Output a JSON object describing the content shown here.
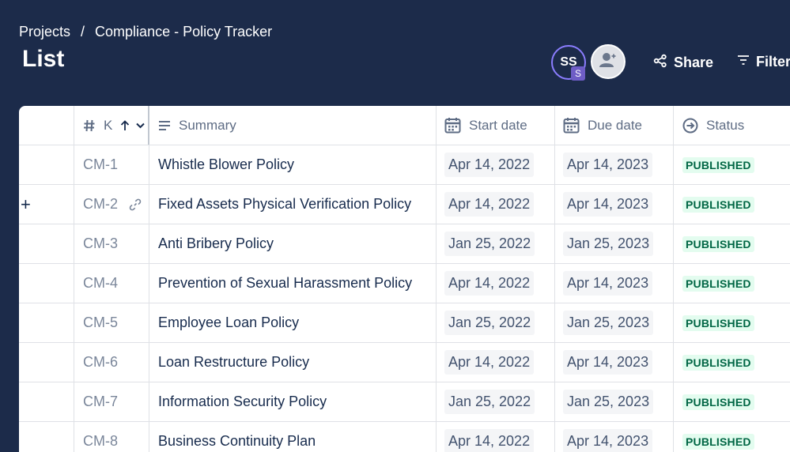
{
  "header": {
    "breadcrumb": [
      "Projects",
      "/",
      "Compliance - Policy Tracker"
    ],
    "title": "List",
    "avatar_initials": "SS",
    "avatar_badge": "S",
    "share_label": "Share",
    "filter_label": "Filter"
  },
  "table": {
    "columns": {
      "key": "K",
      "summary": "Summary",
      "start": "Start date",
      "due": "Due date",
      "status": "Status"
    },
    "rows": [
      {
        "key": "CM-1",
        "summary": "Whistle Blower Policy",
        "start": "Apr 14, 2022",
        "due": "Apr 14, 2023",
        "status": "PUBLISHED"
      },
      {
        "key": "CM-2",
        "summary": "Fixed Assets Physical Verification Policy",
        "start": "Apr 14, 2022",
        "due": "Apr 14, 2023",
        "status": "PUBLISHED"
      },
      {
        "key": "CM-3",
        "summary": "Anti Bribery Policy",
        "start": "Jan 25, 2022",
        "due": "Jan 25, 2023",
        "status": "PUBLISHED"
      },
      {
        "key": "CM-4",
        "summary": "Prevention of Sexual Harassment Policy",
        "start": "Apr 14, 2022",
        "due": "Apr 14, 2023",
        "status": "PUBLISHED"
      },
      {
        "key": "CM-5",
        "summary": "Employee Loan Policy",
        "start": "Jan 25, 2022",
        "due": "Jan 25, 2023",
        "status": "PUBLISHED"
      },
      {
        "key": "CM-6",
        "summary": "Loan Restructure Policy",
        "start": "Apr 14, 2022",
        "due": "Apr 14, 2023",
        "status": "PUBLISHED"
      },
      {
        "key": "CM-7",
        "summary": "Information Security Policy",
        "start": "Jan 25, 2022",
        "due": "Jan 25, 2023",
        "status": "PUBLISHED"
      },
      {
        "key": "CM-8",
        "summary": "Business Continuity Plan",
        "start": "Apr 14, 2022",
        "due": "Apr 14, 2023",
        "status": "PUBLISHED"
      }
    ],
    "row_add_symbol": "+",
    "colors": {
      "status_bg": "#e3fcef",
      "status_fg": "#006644",
      "header_bg": "#1c2b4a"
    }
  },
  "icons": [
    "hash-icon",
    "sort-up-icon",
    "chevron-down-icon",
    "lines-icon",
    "calendar-icon",
    "status-circle-arrow-icon",
    "share-icon",
    "filter-icon",
    "add-person-icon",
    "link-icon",
    "plus-icon"
  ]
}
